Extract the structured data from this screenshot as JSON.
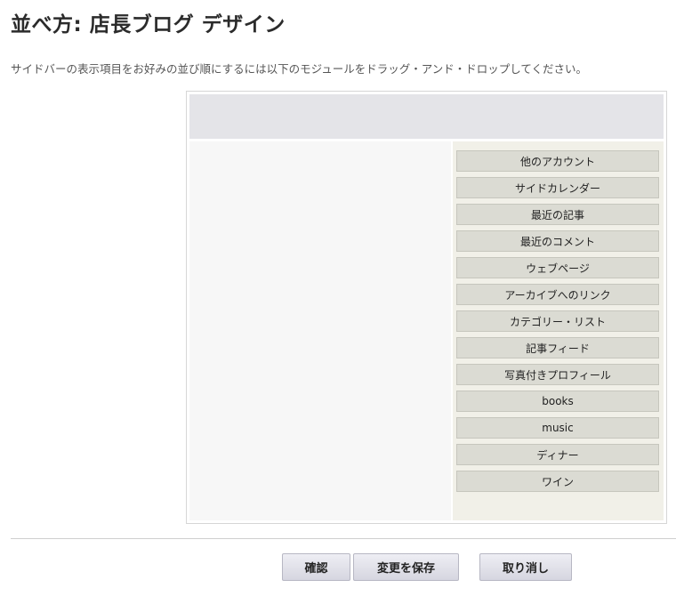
{
  "page": {
    "title": "並べ方: 店長ブログ デザイン",
    "instructions": "サイドバーの表示項目をお好みの並び順にするには以下のモジュールをドラッグ・アンド・ドロップしてください。"
  },
  "modules": [
    "他のアカウント",
    "サイドカレンダー",
    "最近の記事",
    "最近のコメント",
    "ウェブページ",
    "アーカイブへのリンク",
    "カテゴリー・リスト",
    "記事フィード",
    "写真付きプロフィール",
    "books",
    "music",
    "ディナー",
    "ワイン"
  ],
  "buttons": {
    "confirm": "確認",
    "save": "変更を保存",
    "cancel": "取り消し"
  }
}
